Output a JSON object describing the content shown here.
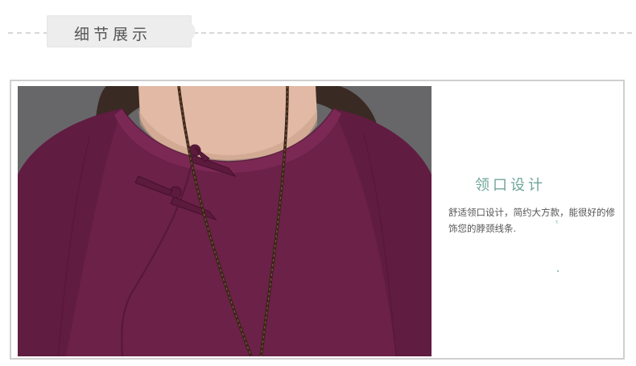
{
  "header": {
    "title": "细节展示"
  },
  "feature": {
    "title": "领口设计",
    "description": "舒适领口设计，简约大方款，能很好的修饰您的脖颈线条."
  },
  "photo": {
    "icon": "product-detail-photo",
    "garment_color": "#6b2148"
  },
  "colors": {
    "accent": "#6fa59a",
    "frame": "#cfcfcf"
  }
}
